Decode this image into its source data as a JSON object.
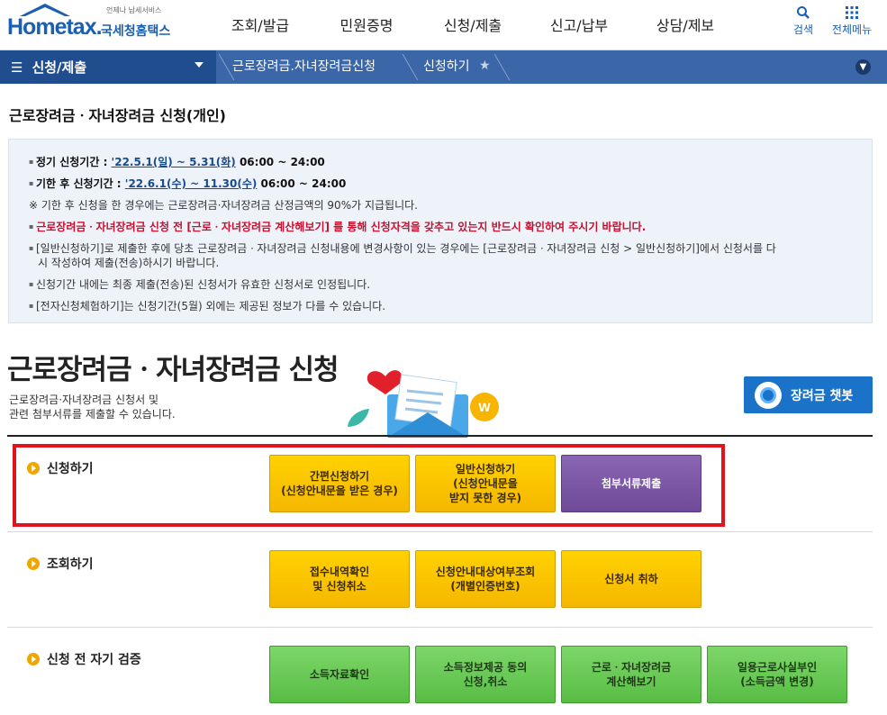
{
  "header": {
    "logo_tag": "언제나 납세서비스",
    "logo_text_a": "Hom",
    "logo_text_e": "e",
    "logo_text_b": "tax.",
    "logo_org": "국세청홈택스",
    "menu": [
      "조회/발급",
      "민원증명",
      "신청/제출",
      "신고/납부",
      "상담/제보"
    ],
    "search_label": "검색",
    "all_menu_label": "전체메뉴"
  },
  "navbar": {
    "current": "신청/제출",
    "crumb1": "근로장려금.자녀장려금신청",
    "crumb2": "신청하기"
  },
  "page_title": "근로장려금ㆍ자녀장려금 신청(개인)",
  "notice": {
    "regular_label": "정기 신청기간 : ",
    "regular_period": "'22.5.1(일) ~ 5.31(화)",
    "regular_time": " 06:00 ~ 24:00",
    "late_label": "기한 후 신청기간 : ",
    "late_period": "'22.6.1(수) ~ 11.30(수)",
    "late_time": " 06:00 ~ 24:00",
    "note": "※ 기한 후 신청을 한 경우에는 근로장려금·자녀장려금 산정금액의 90%가 지급됩니다.",
    "warning": "근로장려금ㆍ자녀장려금 신청 전 [근로ㆍ자녀장려금 계산해보기] 를 통해 신청자격을 갖추고 있는지 반드시 확인하여 주시기 바랍니다.",
    "general_a": "[일반신청하기]로 제출한 후에 당초 근로장려금ㆍ자녀장려금 신청내용에 변경사항이 있는 경우에는  [근로장려금ㆍ자녀장려금 신청 > 일반신청하기]에서  신청서를 다",
    "general_b": "시 작성하여 제출(전송)하시기 바랍니다.",
    "valid": "신청기간 내에는 최종 제출(전송)된 신청서가 유효한 신청서로 인정됩니다.",
    "trial": "[전자신청체험하기]는 신청기간(5월) 외에는 제공된 정보가 다를 수 있습니다."
  },
  "main": {
    "heading": "근로장려금ㆍ자녀장려금 신청",
    "desc_a": "근로장려금·자녀장려금 신청서 및",
    "desc_b": "관련 첨부서류를 제출할 수 있습니다.",
    "chatbot": "장려금 챗봇"
  },
  "sections": {
    "apply": {
      "label": "신청하기",
      "buttons": [
        "간편신청하기\n(신청안내문을 받은 경우)",
        "일반신청하기\n(신청안내문을\n받지 못한 경우)",
        "첨부서류제출"
      ]
    },
    "inquiry": {
      "label": "조회하기",
      "buttons": [
        "접수내역확인\n및 신청취소",
        "신청안내대상여부조회\n(개별인증번호)",
        "신청서 취하"
      ]
    },
    "selfcheck": {
      "label": "신청 전 자기 검증",
      "buttons": [
        "소득자료확인",
        "소득정보제공 동의\n신청,취소",
        "근로ㆍ자녀장려금\n계산해보기",
        "일용근로사실부인\n(소득금액 변경)"
      ]
    }
  },
  "colors": {
    "brand_blue": "#1a5fb4",
    "nav_blue": "#3b66a8",
    "button_yellow": "#f5b700",
    "button_purple": "#6e4a99",
    "button_green": "#58bd44",
    "highlight_red": "#e0141e"
  }
}
